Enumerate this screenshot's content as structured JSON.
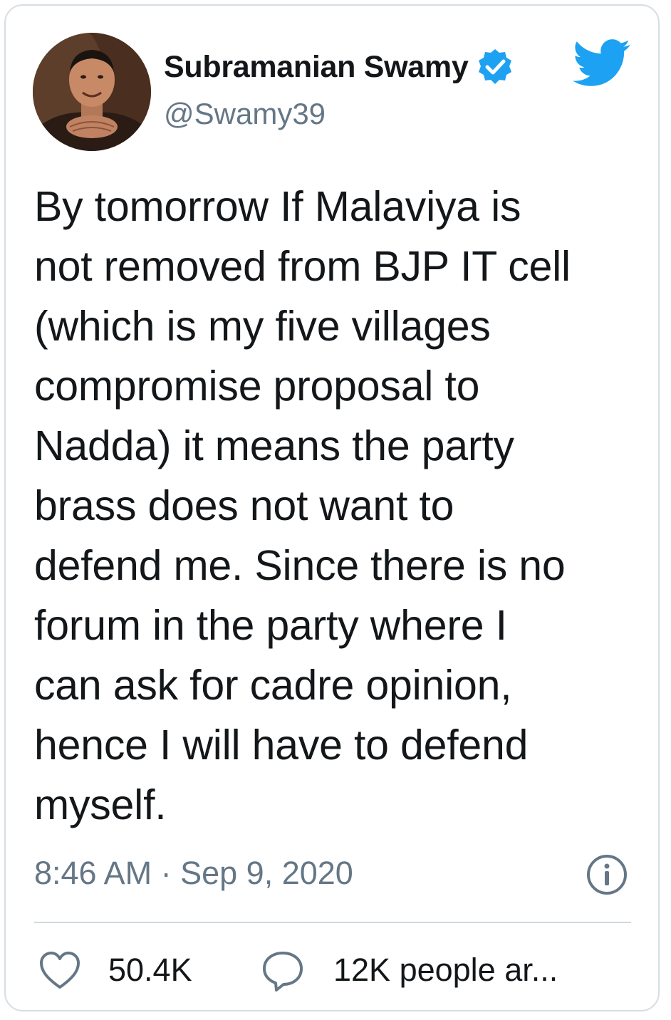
{
  "user": {
    "display_name": "Subramanian Swamy",
    "handle": "@Swamy39",
    "verified": true,
    "avatar_icon": "profile-photo"
  },
  "tweet": {
    "text": "By tomorrow If Malaviya is\nnot removed from BJP IT cell\n(which is my five villages\ncompromise proposal to\nNadda) it means the party\nbrass does not want to\ndefend me. Since there is no\nforum in the party where I\ncan ask for cadre opinion,\nhence I will have to defend\nmyself.",
    "timestamp": "8:46 AM · Sep 9, 2020"
  },
  "actions": {
    "like_count": "50.4K",
    "talking_about": "12K people ar..."
  },
  "icons": {
    "brand": "twitter-bird-icon",
    "verified": "verified-badge-icon",
    "info": "info-icon",
    "like": "heart-icon",
    "reply": "speech-bubble-icon"
  },
  "colors": {
    "brand_blue": "#1DA1F2",
    "text_primary": "#14171a",
    "text_secondary": "#657786",
    "divider": "#cfd9de"
  }
}
